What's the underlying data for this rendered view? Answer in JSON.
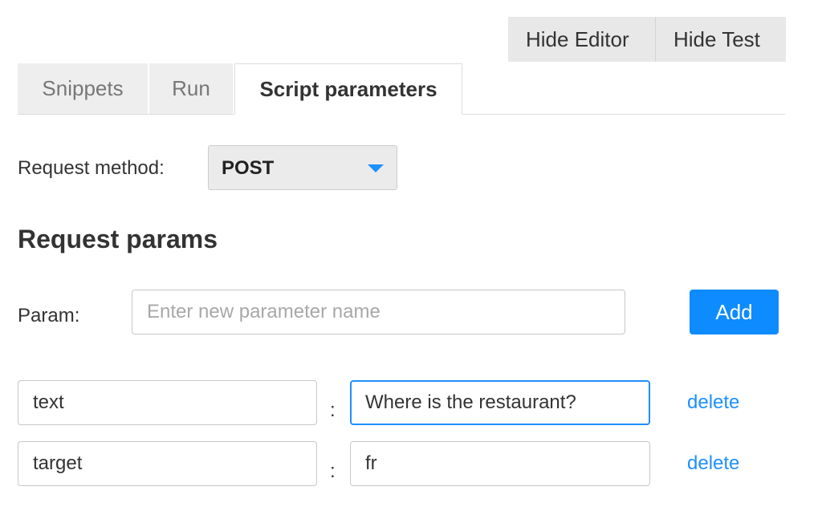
{
  "toolbar": {
    "hide_editor": "Hide Editor",
    "hide_test": "Hide Test"
  },
  "tabs": [
    {
      "label": "Snippets",
      "active": false
    },
    {
      "label": "Run",
      "active": false
    },
    {
      "label": "Script parameters",
      "active": true
    }
  ],
  "request_method": {
    "label": "Request method:",
    "selected": "POST"
  },
  "request_params": {
    "title": "Request params",
    "param_label": "Param:",
    "new_param_placeholder": "Enter new parameter name",
    "add_label": "Add",
    "rows": [
      {
        "key": "text",
        "value": "Where is the restaurant?",
        "delete_label": "delete"
      },
      {
        "key": "target",
        "value": "fr",
        "delete_label": "delete"
      }
    ],
    "separator": ":"
  },
  "colors": {
    "accent": "#1e8fff",
    "add_button": "#0d8bff",
    "toggle_bg": "#e8e8e8",
    "tab_inactive_bg": "#eeeeee"
  }
}
